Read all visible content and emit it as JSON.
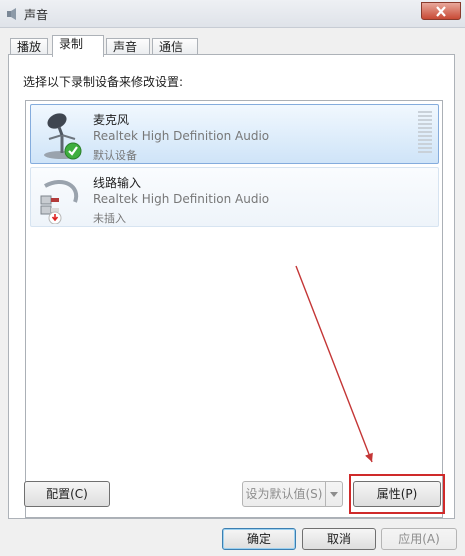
{
  "window": {
    "title": "声音"
  },
  "tabs": [
    {
      "label": "播放",
      "active": false
    },
    {
      "label": "录制",
      "active": true
    },
    {
      "label": "声音",
      "active": false
    },
    {
      "label": "通信",
      "active": false
    }
  ],
  "panel": {
    "instruction": "选择以下录制设备来修改设置:"
  },
  "devices": [
    {
      "name": "麦克风",
      "driver": "Realtek High Definition Audio",
      "status": "默认设备",
      "icon": "microphone-icon",
      "badge": "checkmark-icon",
      "selected": true
    },
    {
      "name": "线路输入",
      "driver": "Realtek High Definition Audio",
      "status": "未插入",
      "icon": "line-in-icon",
      "badge": "unplugged-icon",
      "selected": false
    }
  ],
  "buttons": {
    "configure": "配置(C)",
    "set_default": "设为默认值(S)",
    "properties": "属性(P)",
    "ok": "确定",
    "cancel": "取消",
    "apply": "应用(A)"
  },
  "colors": {
    "highlight": "#cf2a2a",
    "selection": "#84acdd"
  }
}
